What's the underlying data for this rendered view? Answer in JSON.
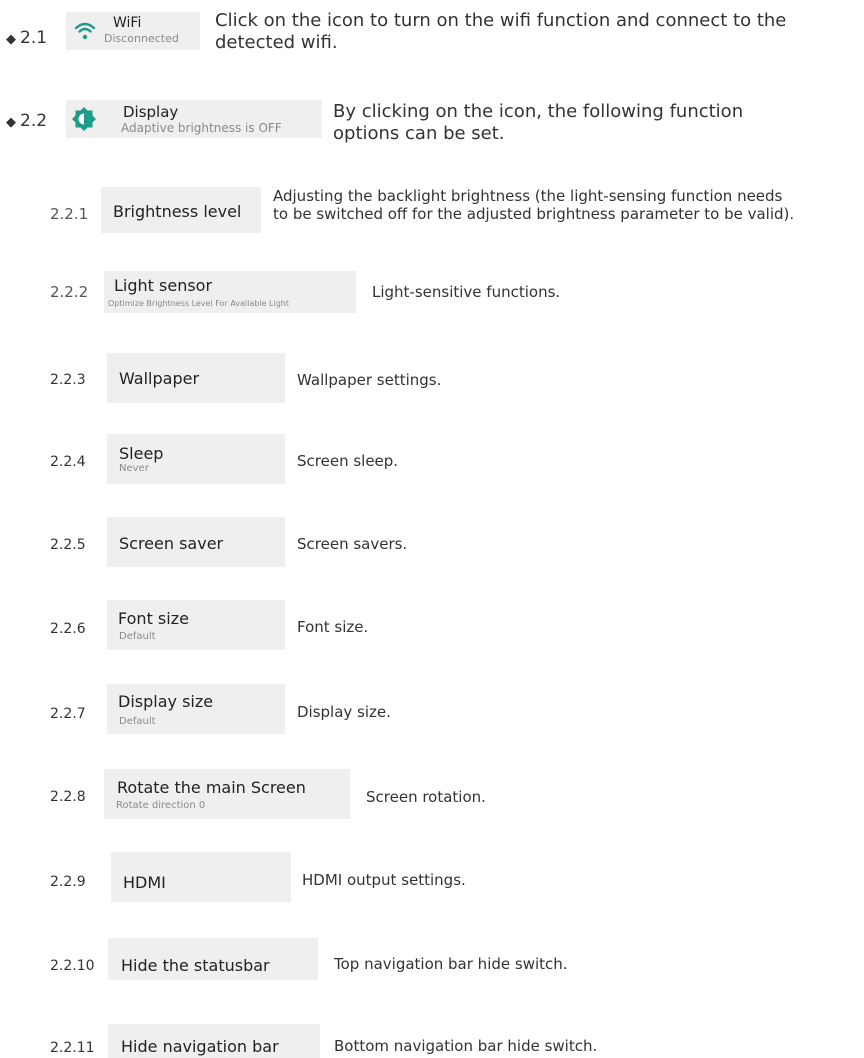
{
  "sections": {
    "wifi": {
      "number": "2.1",
      "title": "WiFi",
      "subtitle": "Disconnected",
      "description_line1": "Click on the icon to turn on the wifi function and connect to the",
      "description_line2": "detected wifi."
    },
    "display": {
      "number": "2.2",
      "title": "Display",
      "subtitle": "Adaptive brightness is OFF",
      "description_line1": "By clicking on the icon, the following function",
      "description_line2": "options can be set."
    }
  },
  "items": [
    {
      "number": "2.2.1",
      "title": "Brightness level",
      "subtitle": "",
      "description_line1": "Adjusting the backlight brightness (the light-sensing function needs",
      "description_line2": "to be switched off for the adjusted brightness parameter to be valid)."
    },
    {
      "number": "2.2.2",
      "title": "Light sensor",
      "subtitle": "Optimize Brightness Level For Available Light",
      "description": "Light-sensitive functions."
    },
    {
      "number": "2.2.3",
      "title": "Wallpaper",
      "subtitle": "",
      "description": "Wallpaper settings."
    },
    {
      "number": "2.2.4",
      "title": "Sleep",
      "subtitle": "Never",
      "description": "Screen sleep."
    },
    {
      "number": "2.2.5",
      "title": "Screen saver",
      "subtitle": "",
      "description": "Screen savers."
    },
    {
      "number": "2.2.6",
      "title": "Font size",
      "subtitle": "Default",
      "description": "Font size."
    },
    {
      "number": "2.2.7",
      "title": "Display size",
      "subtitle": "Default",
      "description": "Display size."
    },
    {
      "number": "2.2.8",
      "title": "Rotate the main Screen",
      "subtitle": "Rotate direction 0",
      "description": "Screen rotation."
    },
    {
      "number": "2.2.9",
      "title": "HDMI",
      "subtitle": "",
      "description": "HDMI output settings."
    },
    {
      "number": "2.2.10",
      "title": "Hide the statusbar",
      "subtitle": "",
      "description": "Top navigation bar hide switch."
    },
    {
      "number": "2.2.11",
      "title": "Hide navigation bar",
      "subtitle": "",
      "description": "Bottom navigation bar hide switch."
    }
  ],
  "colors": {
    "accent": "#1c9a8a",
    "tile_background": "#efefef",
    "text": "#333333",
    "muted": "#8a8a8a"
  },
  "icons": {
    "wifi": "wifi-icon",
    "display": "brightness-icon",
    "bullet": "diamond-bullet-icon"
  }
}
